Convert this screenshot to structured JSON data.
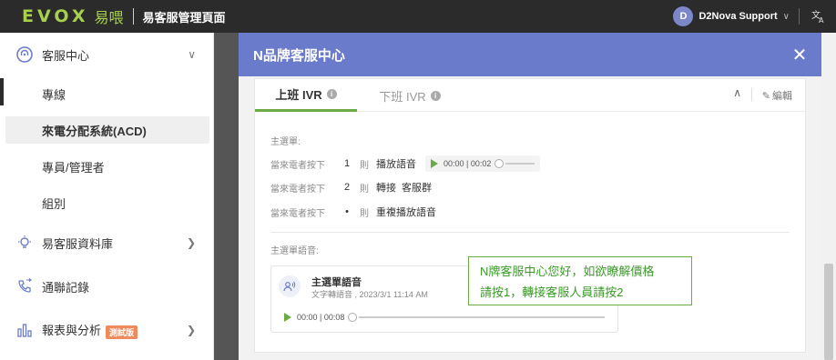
{
  "app": {
    "logo_text": "EVOX",
    "logo_cn": "易喂",
    "title": "易客服管理頁面",
    "user_initial": "D",
    "user_name": "D2Nova Support"
  },
  "sidebar": {
    "items": [
      {
        "label": "客服中心",
        "icon": "headset-icon",
        "expanded": true
      },
      {
        "label": "專線"
      },
      {
        "label": "來電分配系統(ACD)",
        "active": true
      },
      {
        "label": "專員/管理者"
      },
      {
        "label": "組別"
      },
      {
        "label": "易客服資料庫",
        "icon": "lightbulb-icon"
      },
      {
        "label": "通聯記錄",
        "icon": "phone-log-icon"
      },
      {
        "label": "報表與分析",
        "icon": "bar-chart-icon",
        "badge": "測試版"
      }
    ]
  },
  "modal": {
    "title": "N品牌客服中心",
    "tabs": [
      "上班 IVR",
      "下班 IVR"
    ],
    "edit_label": "編輯",
    "main_menu_label": "主選單:",
    "rows": [
      {
        "prefix": "當來電者按下",
        "key": "1",
        "then": "則",
        "action": "播放語音",
        "player_time": "00:00 | 00:02"
      },
      {
        "prefix": "當來電者按下",
        "key": "2",
        "then": "則",
        "action": "轉接",
        "target": "客服群"
      },
      {
        "prefix": "當來電者按下",
        "key": "•",
        "then": "則",
        "action": "重複播放語音"
      }
    ],
    "voice_label": "主選單語音:",
    "audio": {
      "title": "主選單語音",
      "subtitle": "文字轉語音 , 2023/3/1 11:14 AM",
      "time": "00:00 | 00:08"
    },
    "tooltip_lines": [
      "N牌客服中心您好，如欲瞭解價格",
      "請按1，轉接客服人員請按2"
    ]
  },
  "colors": {
    "modal_header": "#6a7bcb",
    "accent_green": "#6aab45",
    "beta_badge": "#f08a5d",
    "topbar": "#2b2b2b"
  }
}
